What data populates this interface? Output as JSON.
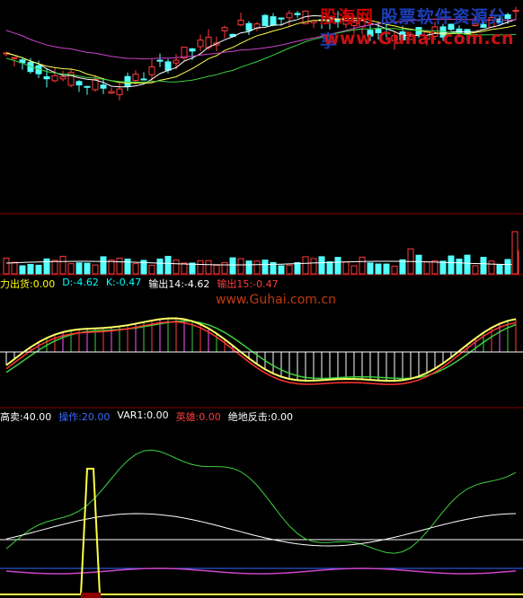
{
  "watermark": {
    "brand": "股海网",
    "slogan": "股票软件资源分享",
    "url": "www.Guhai.com.cn",
    "mid_url": "www.Guhai.com.cn"
  },
  "macd_panel": {
    "items": [
      {
        "text": "力出货:0.00",
        "color": "#ffff00"
      },
      {
        "text": "D:-4.62",
        "color": "#00ffff"
      },
      {
        "text": "K:-0.47",
        "color": "#00ffff"
      },
      {
        "text": "输出14:-4.62",
        "color": "#ffffff"
      },
      {
        "text": "输出15:-0.47",
        "color": "#ff3b3b"
      }
    ]
  },
  "osc_panel": {
    "items": [
      {
        "text": "高卖:40.00",
        "color": "#ffffff"
      },
      {
        "text": "操作:20.00",
        "color": "#3a6bff"
      },
      {
        "text": "VAR1:0.00",
        "color": "#ffffff"
      },
      {
        "text": "英雄:0.00",
        "color": "#ff3b3b"
      },
      {
        "text": "绝地反击:0.00",
        "color": "#ffffff"
      }
    ]
  },
  "colors": {
    "up": "#ff3b3b",
    "down": "#53ffff",
    "ma1": "#ffffff",
    "ma2": "#ffff4d",
    "ma3": "#cc44cc",
    "ma4": "#3fd03f",
    "separator": "#8b0000"
  }
}
